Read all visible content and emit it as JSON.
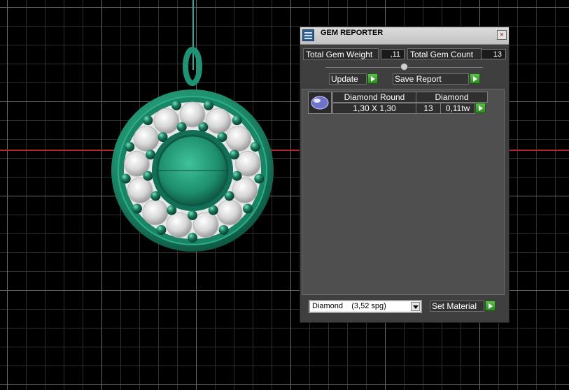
{
  "panel": {
    "title": "GEM REPORTER",
    "close_glyph": "×",
    "total_weight_label": "Total Gem Weight",
    "total_weight_value": ",11",
    "total_count_label": "Total Gem Count",
    "total_count_value": "13",
    "update_label": "Update",
    "save_report_label": "Save Report",
    "table": {
      "shape_header": "Diamond Round",
      "material_header": "Diamond",
      "size": "1,30 X 1,30",
      "count": "13",
      "weight": "0,11tw"
    },
    "material_select_value": "Diamond    (3,52 spg)",
    "set_material_label": "Set Material"
  },
  "icons": {
    "app": "gem-reporter-icon",
    "close": "close-icon",
    "go": "green-arrow-icon",
    "gem": "round-gem-icon",
    "dropdown": "chevron-down-icon"
  },
  "colors": {
    "metal": "#1f9474",
    "cable": "#2ea79b",
    "axis": "#b3262a",
    "panel_bg": "#3f3f3f",
    "go_button": "#3faa2f"
  }
}
